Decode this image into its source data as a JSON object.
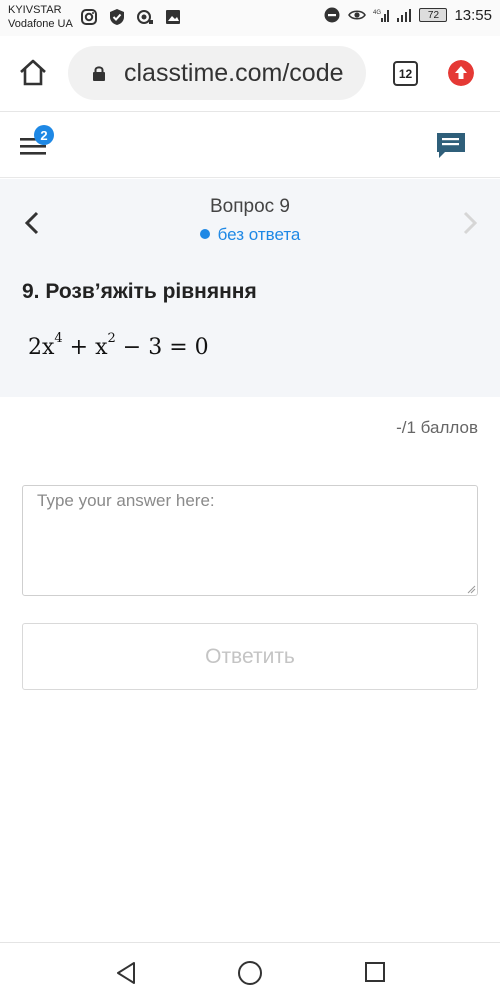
{
  "status_bar": {
    "carrier_1": "KYIVSTAR",
    "carrier_2": "Vodafone UA",
    "network_label": "4G",
    "battery": "72",
    "time": "13:55",
    "icons_left": [
      "instagram-icon",
      "shield-check-icon",
      "camera-icon",
      "image-icon"
    ],
    "icons_right": [
      "do-not-disturb-icon",
      "eye-icon",
      "signal-icon",
      "signal-icon",
      "battery-icon"
    ]
  },
  "browser": {
    "url": "classtime.com/code",
    "tab_count": "12",
    "update_color": "#e53935"
  },
  "app_header": {
    "notification_count": "2",
    "accent_color": "#1e88e5"
  },
  "question": {
    "nav_title": "Вопрос 9",
    "status": "без ответа",
    "heading": "9. Розв’яжіть рівняння",
    "equation": {
      "coef": "2x",
      "exp1": "4",
      "mid": " + x",
      "exp2": "2",
      "rest": " − 3 = 0"
    }
  },
  "points": "-/1 баллов",
  "answer": {
    "placeholder": "Type your answer here:",
    "value": ""
  },
  "submit_label": "Ответить"
}
